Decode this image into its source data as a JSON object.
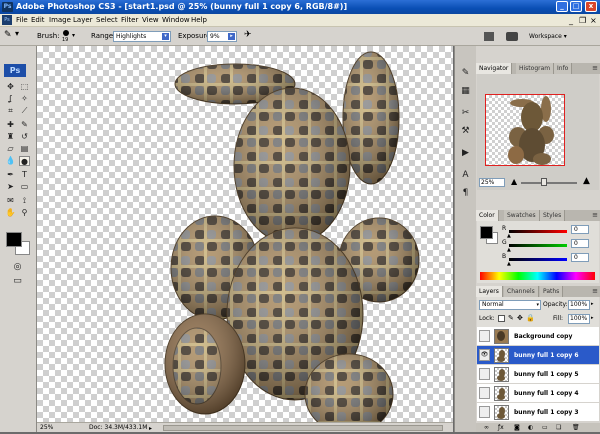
{
  "window": {
    "title": "Adobe Photoshop CS3 - [start1.psd @ 25% (bunny full 1 copy 6, RGB/8#)]",
    "app_icon": "Ps",
    "buttons": [
      "_",
      "□",
      "x"
    ]
  },
  "menubar": {
    "items": [
      "File",
      "Edit",
      "Image",
      "Layer",
      "Select",
      "Filter",
      "View",
      "Window",
      "Help"
    ]
  },
  "options": {
    "brush_label": "Brush:",
    "brush_size": "19",
    "range_label": "Range:",
    "range_value": "Highlights",
    "exposure_label": "Exposure:",
    "exposure_value": "9%",
    "workspace_label": "Workspace ▾"
  },
  "toolbox": {
    "logo": "Ps"
  },
  "status": {
    "zoom": "25%",
    "doc": "Doc: 34.3M/433.1M"
  },
  "navigator": {
    "tabs": [
      "Navigator",
      "Histogram",
      "Info"
    ],
    "zoom": "25%"
  },
  "color_panel": {
    "tabs": [
      "Color",
      "Swatches",
      "Styles"
    ],
    "channels": [
      {
        "label": "R",
        "value": "0"
      },
      {
        "label": "G",
        "value": "0"
      },
      {
        "label": "B",
        "value": "0"
      }
    ]
  },
  "layers_panel": {
    "tabs": [
      "Layers",
      "Channels",
      "Paths"
    ],
    "blend_mode": "Normal",
    "opacity_label": "Opacity:",
    "opacity_value": "100%",
    "lock_label": "Lock:",
    "fill_label": "Fill:",
    "fill_value": "100%",
    "layers": [
      {
        "name": "Background copy",
        "visible": false,
        "selected": false
      },
      {
        "name": "bunny full 1 copy 6",
        "visible": true,
        "selected": true
      },
      {
        "name": "bunny full 1 copy 5",
        "visible": false,
        "selected": false
      },
      {
        "name": "bunny full 1 copy 4",
        "visible": false,
        "selected": false
      },
      {
        "name": "bunny full 1 copy 3",
        "visible": false,
        "selected": false
      }
    ]
  },
  "colors": {
    "title_blue": "#0a4fb5",
    "selected_layer": "#2a5ac9",
    "fur_tan": "#a98a5e",
    "fur_dark": "#3a2f22"
  }
}
